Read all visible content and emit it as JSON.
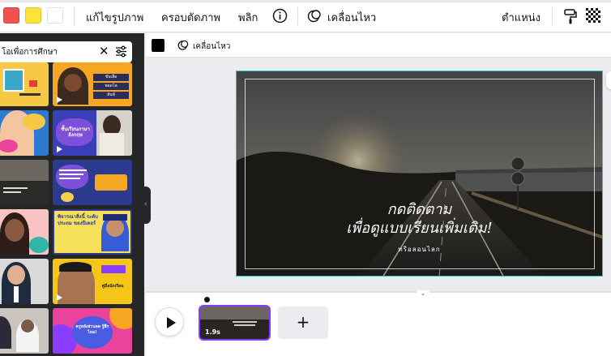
{
  "toolbar": {
    "colors": [
      "#ee5350",
      "#fce33a",
      "#ffffff"
    ],
    "edit_image": "แก้ไขรูปภาพ",
    "crop": "ครอบตัดภาพ",
    "flip": "พลิก",
    "animate": "เคลื่อนไหว",
    "position": "ตำแหน่ง"
  },
  "sidebar": {
    "search_value": "โอเพื่อการศึกษา",
    "thumb_texts": {
      "t2_a": "ขับเลือ",
      "t2_b": "พอดโล",
      "t2_c": "สันท์",
      "t4": "ชั้นเรียนภาษาอังกฤษ",
      "t8": "พิจารณาสิ่งนี้ ระดับประถม ของปีเตอร์",
      "t10": "คู่มือนักเรียน",
      "t12": "ครูหลังส่วนลด รู้สึกไหม!"
    }
  },
  "subbar": {
    "color": "#000000",
    "animate": "เคลื่อนไหว"
  },
  "canvas": {
    "title_line1": "กดติดตาม",
    "title_line2": "เพื่อดูแบบเรียนเพิ่มเติม!",
    "handle": "ทรีอลอนไลก"
  },
  "timeline": {
    "clip_duration": "1.9s"
  }
}
